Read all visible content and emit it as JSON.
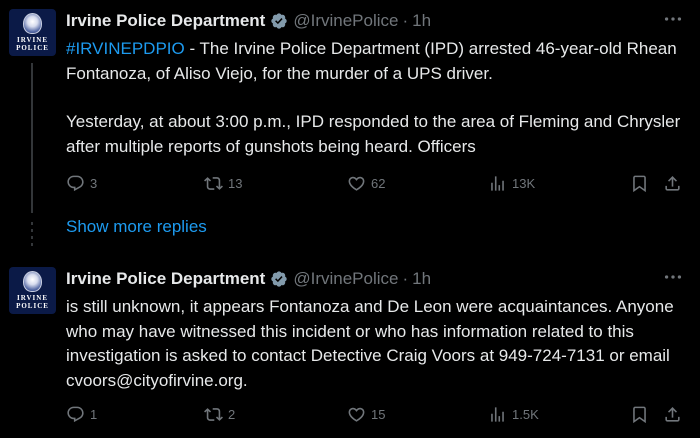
{
  "colors": {
    "background": "#000000",
    "text": "#e7e9ea",
    "muted": "#71767b",
    "accent": "#1d9bf0",
    "verified": "#829aab"
  },
  "avatar_text": [
    "IRVINE",
    "POLICE"
  ],
  "tweets": [
    {
      "name": "Irvine Police Department",
      "handle": "@IrvinePolice",
      "separator": "·",
      "time": "1h",
      "hashtag": "#IRVINEPDPIO",
      "text_p1": " - The Irvine Police Department (IPD) arrested 46-year-old Rhean Fontanoza, of Aliso Viejo, for the murder of a UPS driver.",
      "text_p2": "Yesterday, at about 3:00 p.m., IPD responded to the area of Fleming and Chrysler after multiple reports of gunshots being heard. Officers",
      "replies": "3",
      "reposts": "13",
      "likes": "62",
      "views": "13K"
    },
    {
      "name": "Irvine Police Department",
      "handle": "@IrvinePolice",
      "separator": "·",
      "time": "1h",
      "text_p1": "is still unknown, it appears Fontanoza and De Leon were acquaintances. Anyone who may have witnessed this incident or who has information related to this investigation is asked to contact Detective Craig Voors at 949-724-7131 or email cvoors@cityofirvine.org.",
      "replies": "1",
      "reposts": "2",
      "likes": "15",
      "views": "1.5K"
    }
  ],
  "show_more_replies": "Show more replies",
  "icons": {
    "verified": "verified-badge-icon",
    "more": "more-options-icon",
    "reply": "reply-icon",
    "repost": "repost-icon",
    "like": "heart-icon",
    "views": "views-chart-icon",
    "bookmark": "bookmark-icon",
    "share": "share-icon"
  }
}
